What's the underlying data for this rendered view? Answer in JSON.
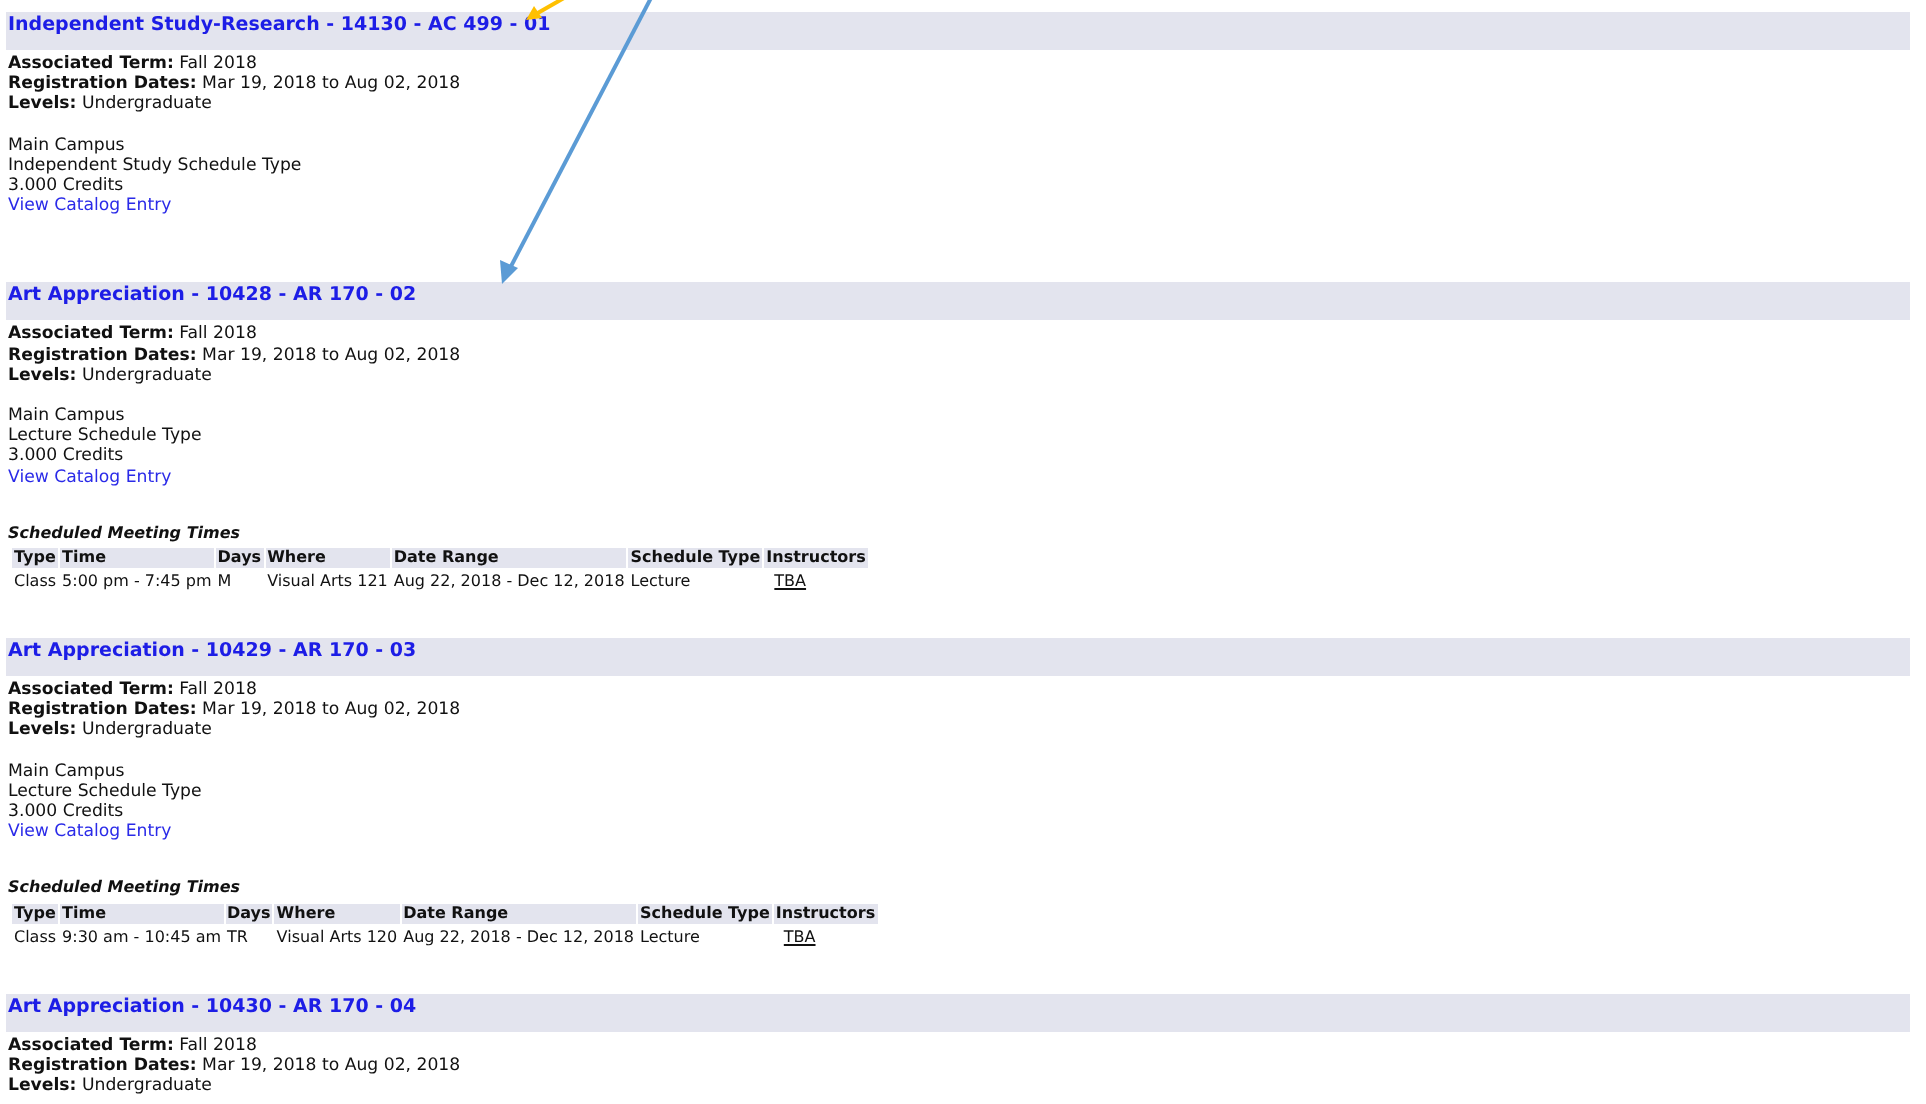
{
  "sections": [
    {
      "title": "Independent Study-Research - 14130 - AC 499 - 01",
      "fields": [
        {
          "label": "Associated Term:",
          "value": "Fall 2018"
        },
        {
          "label": "Registration Dates:",
          "value": "Mar 19, 2018 to Aug 02, 2018"
        },
        {
          "label": "Levels:",
          "value": "Undergraduate"
        }
      ],
      "info": [
        "Main Campus",
        "Independent Study Schedule Type",
        "3.000 Credits"
      ],
      "link": "View Catalog Entry"
    },
    {
      "title": "Art Appreciation - 10428 - AR 170 - 02",
      "fields": [
        {
          "label": "Associated Term:",
          "value": "Fall 2018"
        },
        {
          "label": "Registration Dates:",
          "value": "Mar 19, 2018 to Aug 02, 2018"
        },
        {
          "label": "Levels:",
          "value": "Undergraduate"
        }
      ],
      "info": [
        "Main Campus",
        "Lecture Schedule Type",
        "3.000 Credits"
      ],
      "link": "View Catalog Entry",
      "meetings": {
        "caption": "Scheduled Meeting Times",
        "columns": [
          "Type",
          "Time",
          "Days",
          "Where",
          "Date Range",
          "Schedule Type",
          "Instructors"
        ],
        "rows": [
          [
            "Class",
            "5:00 pm - 7:45 pm",
            "M",
            "Visual Arts 121",
            "Aug 22, 2018 - Dec 12, 2018",
            "Lecture",
            "TBA"
          ]
        ]
      }
    },
    {
      "title": "Art Appreciation - 10429 - AR 170 - 03",
      "fields": [
        {
          "label": "Associated Term:",
          "value": "Fall 2018"
        },
        {
          "label": "Registration Dates:",
          "value": "Mar 19, 2018 to Aug 02, 2018"
        },
        {
          "label": "Levels:",
          "value": "Undergraduate"
        }
      ],
      "info": [
        "Main Campus",
        "Lecture Schedule Type",
        "3.000 Credits"
      ],
      "link": "View Catalog Entry",
      "meetings": {
        "caption": "Scheduled Meeting Times",
        "columns": [
          "Type",
          "Time",
          "Days",
          "Where",
          "Date Range",
          "Schedule Type",
          "Instructors"
        ],
        "rows": [
          [
            "Class",
            "9:30 am - 10:45 am",
            "TR",
            "Visual Arts 120",
            "Aug 22, 2018 - Dec 12, 2018",
            "Lecture",
            "TBA"
          ]
        ]
      }
    },
    {
      "title": "Art Appreciation - 10430 - AR 170 - 04",
      "fields": [
        {
          "label": "Associated Term:",
          "value": "Fall 2018"
        },
        {
          "label": "Registration Dates:",
          "value": "Mar 19, 2018 to Aug 02, 2018"
        },
        {
          "label": "Levels:",
          "value": "Undergraduate"
        }
      ]
    }
  ]
}
